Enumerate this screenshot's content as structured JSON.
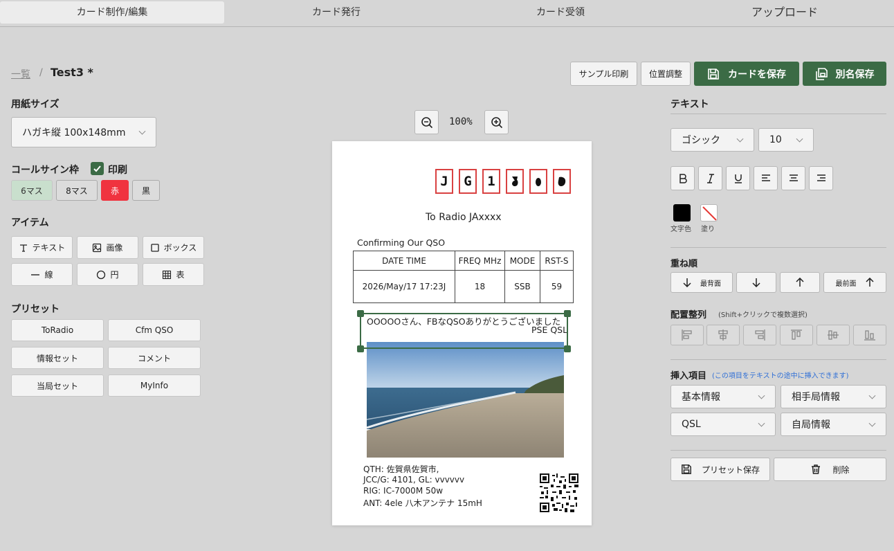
{
  "tabs": [
    {
      "label": "カード制作/編集",
      "active": true
    },
    {
      "label": "カード発行",
      "active": false
    },
    {
      "label": "カード受領",
      "active": false
    },
    {
      "label": "アップロード",
      "active": false
    }
  ],
  "breadcrumb": {
    "link": "一覧",
    "separator": "/",
    "title": "Test3 *"
  },
  "toolbar": {
    "sample_print": "サンプル印刷",
    "position_adjust": "位置調整",
    "save_card": "カードを保存",
    "save_as": "別名保存"
  },
  "left": {
    "paper_size_label": "用紙サイズ",
    "paper_size_value": "ハガキ縦 100x148mm",
    "callsign_frame_label": "コールサイン枠",
    "print_label": "印刷",
    "print_checked": true,
    "frame_options": [
      "6マス",
      "8マス",
      "赤",
      "黒"
    ],
    "items_label": "アイテム",
    "items": [
      "テキスト",
      "画像",
      "ボックス",
      "線",
      "円",
      "表"
    ],
    "preset_label": "プリセット",
    "presets": [
      "ToRadio",
      "Cfm QSO",
      "情報セット",
      "コメント",
      "当局セット",
      "MyInfo"
    ]
  },
  "zoom": {
    "value": "100%"
  },
  "card": {
    "callsign_chars": [
      "J",
      "G",
      "1",
      "",
      "",
      ""
    ],
    "to_radio": "To Radio   JAxxxx",
    "confirming": "Confirming Our QSO",
    "table_headers": [
      "DATE TIME",
      "FREQ MHz",
      "MODE",
      "RST-S"
    ],
    "table_row": [
      "2026/May/17 17:23J",
      "18",
      "SSB",
      "59"
    ],
    "comment_line1": "OOOOOさん、FBなQSOありがとうございました",
    "comment_line2": "PSE QSL",
    "info_lines": [
      "QTH: 佐賀県佐賀市,",
      "JCC/G: 4101, GL: vvvvvv",
      "RIG: IC-7000M  50w",
      "ANT: 4ele 八木アンテナ  15mH"
    ]
  },
  "right": {
    "text_label": "テキスト",
    "font_value": "ゴシック",
    "size_value": "10",
    "text_color_label": "文字色",
    "fill_label": "塗り",
    "colors": {
      "text": "#000000",
      "fill": "none"
    },
    "order_label": "重ね順",
    "order_back": "最背面",
    "order_front": "最前面",
    "align_label": "配置整列",
    "align_hint": "(Shift+クリックで複数選択)",
    "insert_label": "挿入項目",
    "insert_hint": "(この項目をテキストの途中に挿入できます)",
    "insert_selects": [
      "基本情報",
      "相手局情報",
      "QSL",
      "自局情報"
    ],
    "preset_save": "プリセット保存",
    "delete": "削除"
  },
  "accent_colors": {
    "green": "#3b6b45",
    "red": "#f0333f",
    "frame_red": "#d94141"
  }
}
